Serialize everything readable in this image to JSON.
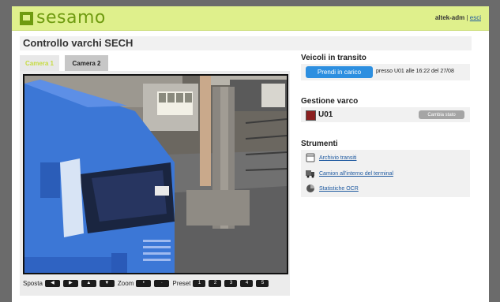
{
  "header": {
    "logo_text": "sesamo",
    "username": "altek-adm",
    "separator": "|",
    "logout_label": "esci",
    "brand_color": "#6f9b10"
  },
  "page": {
    "title": "Controllo varchi SECH"
  },
  "camera": {
    "tabs": [
      {
        "label": "Camera 1",
        "active": true
      },
      {
        "label": "Camera 2",
        "active": false
      }
    ],
    "controls": {
      "move_label": "Sposta",
      "move_buttons": [
        "left-arrow-icon",
        "right-arrow-icon",
        "up-arrow-icon",
        "down-arrow-icon"
      ],
      "zoom_label": "Zoom",
      "zoom_buttons": [
        "zoom-in-icon",
        "zoom-out-icon"
      ],
      "preset_label": "Preset",
      "presets": [
        "1",
        "2",
        "3",
        "4",
        "5"
      ]
    }
  },
  "transit": {
    "title": "Veicoli in transito",
    "take_charge_label": "Prendi in carico",
    "info": "presso U01 alle 16:22 del 27/08"
  },
  "gate": {
    "title": "Gestione varco",
    "name": "U01",
    "status_color": "#8b2020",
    "change_state_label": "Cambia stato"
  },
  "tools": {
    "title": "Strumenti",
    "items": [
      {
        "label": "Archivio transiti",
        "icon": "archive-icon"
      },
      {
        "label": "Camion all'interno del terminal",
        "icon": "truck-icon"
      },
      {
        "label": "Statistiche OCR",
        "icon": "pie-chart-icon"
      }
    ]
  }
}
